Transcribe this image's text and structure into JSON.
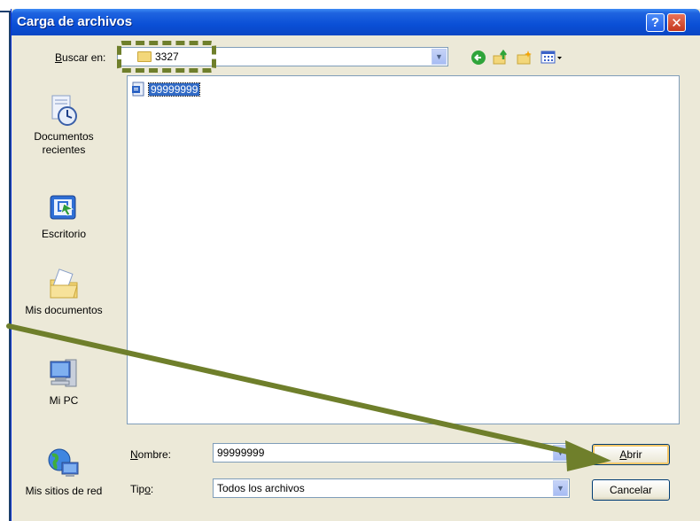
{
  "dialog": {
    "title": "Carga de archivos",
    "help_glyph": "?",
    "close_glyph": "✕"
  },
  "lookin": {
    "label_accel": "B",
    "label_rest": "uscar en:",
    "value": "3327"
  },
  "places": [
    {
      "line1": "Documentos",
      "line2": "recientes"
    },
    {
      "line1": "Escritorio",
      "line2": ""
    },
    {
      "line1": "Mis documentos",
      "line2": ""
    },
    {
      "line1": "Mi PC",
      "line2": ""
    },
    {
      "line1": "Mis sitios de red",
      "line2": ""
    }
  ],
  "files": [
    {
      "name": "99999999",
      "icon": "document-icon"
    }
  ],
  "filename": {
    "label_accel": "N",
    "label_rest": "ombre:",
    "value": "99999999"
  },
  "filetype": {
    "label_pre": "Tip",
    "label_accel": "o",
    "label_post": ":",
    "value": "Todos los archivos"
  },
  "buttons": {
    "open_accel": "A",
    "open_rest": "brir",
    "cancel": "Cancelar"
  },
  "colors": {
    "annotation": "#6f7f2b",
    "selection": "#316ac5"
  }
}
